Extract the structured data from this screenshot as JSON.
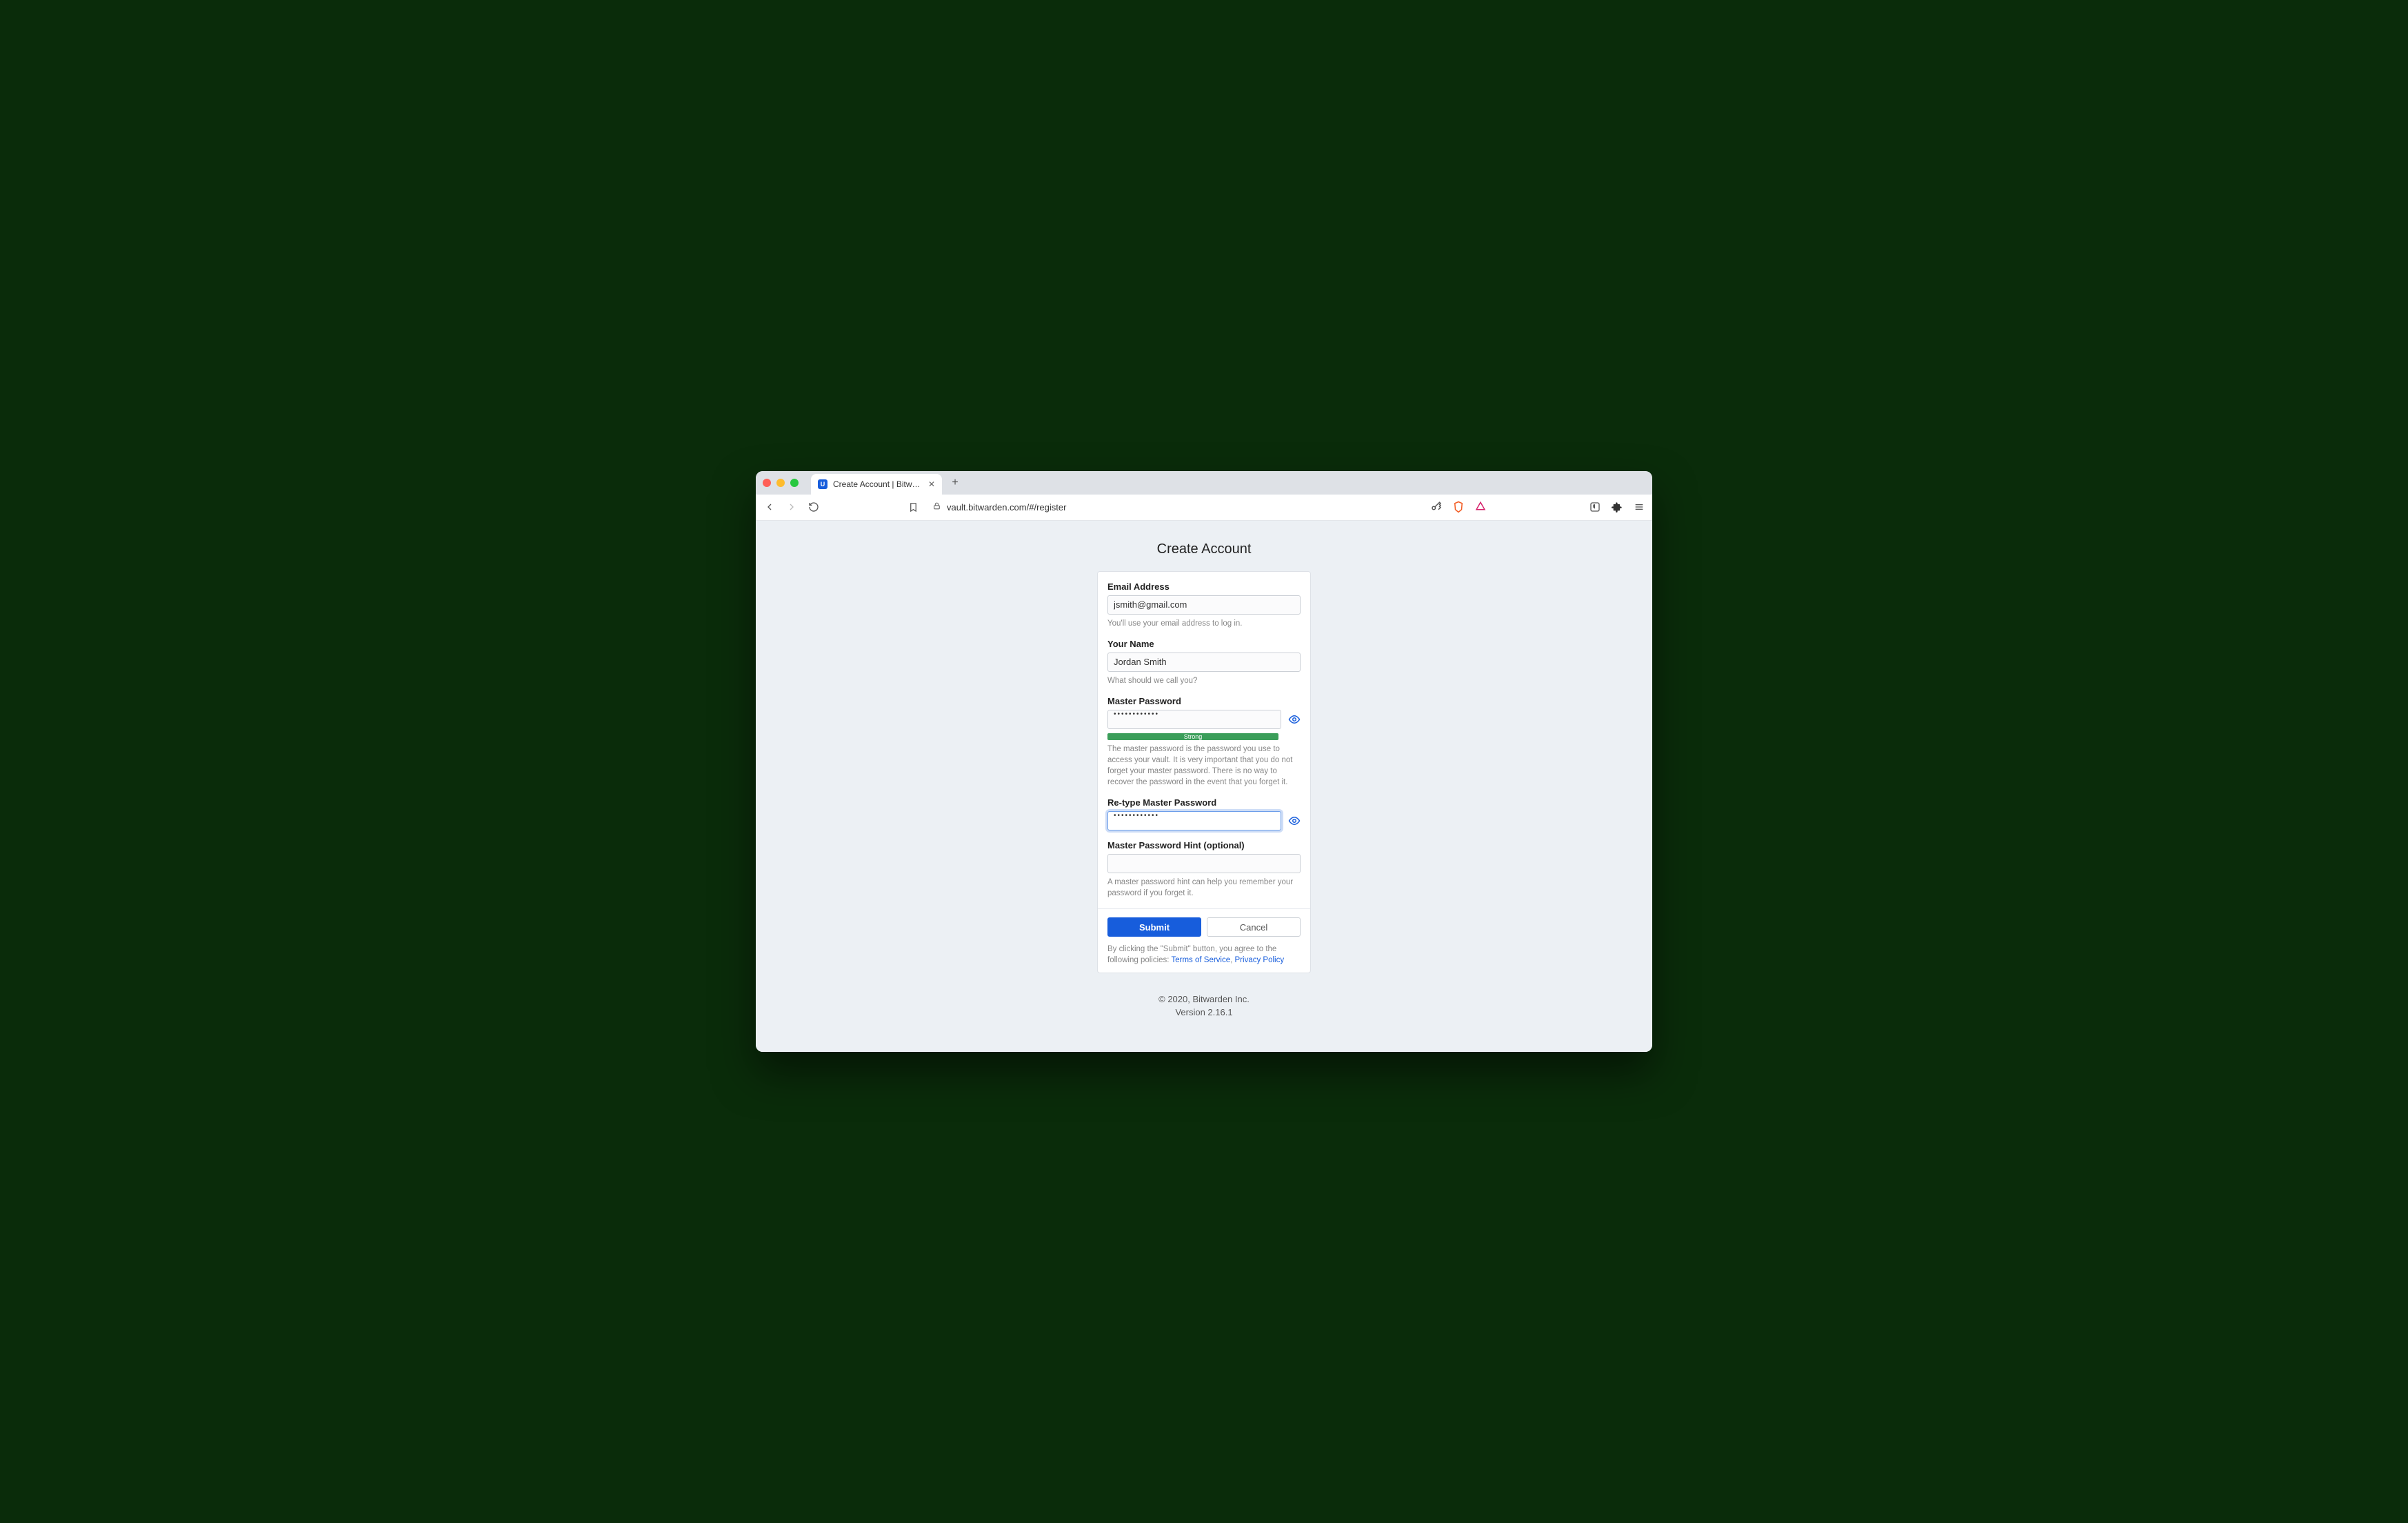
{
  "browser": {
    "tab_title": "Create Account | Bitwarden Web",
    "url": "vault.bitwarden.com/#/register"
  },
  "page": {
    "title": "Create Account"
  },
  "form": {
    "email_label": "Email Address",
    "email_value": "jsmith@gmail.com",
    "email_help": "You'll use your email address to log in.",
    "name_label": "Your Name",
    "name_value": "Jordan Smith",
    "name_help": "What should we call you?",
    "pw_label": "Master Password",
    "pw_value": "••••••••••••",
    "pw_strength": "Strong",
    "pw_help": "The master password is the password you use to access your vault. It is very important that you do not forget your master password. There is no way to recover the password in the event that you forget it.",
    "pw2_label": "Re-type Master Password",
    "pw2_value": "••••••••••••",
    "hint_label": "Master Password Hint (optional)",
    "hint_value": "",
    "hint_help": "A master password hint can help you remember your password if you forget it.",
    "submit_label": "Submit",
    "cancel_label": "Cancel",
    "tos_prefix": "By clicking the \"Submit\" button, you agree to the following policies: ",
    "tos_link": "Terms of Service",
    "tos_sep": ", ",
    "privacy_link": "Privacy Policy"
  },
  "footer": {
    "copyright": "© 2020, Bitwarden Inc.",
    "version": "Version 2.16.1"
  }
}
